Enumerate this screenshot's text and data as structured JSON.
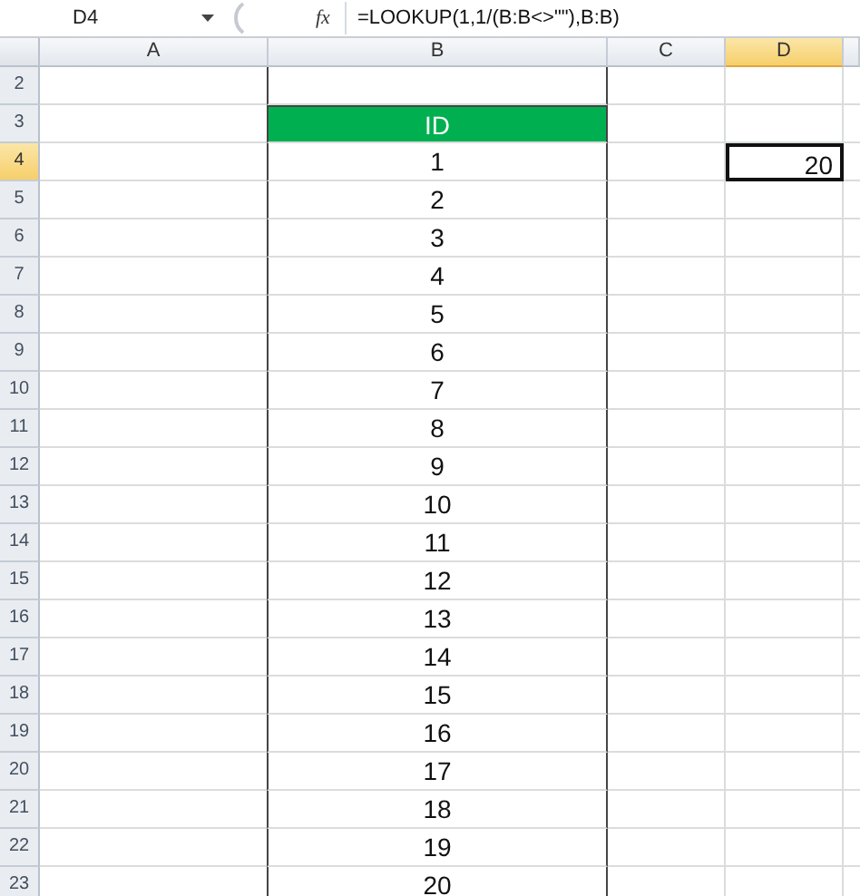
{
  "name_box": "D4",
  "formula_icon": "fx",
  "formula": "=LOOKUP(1,1/(B:B<>\"\"),B:B)",
  "columns": [
    {
      "label": "A",
      "selected": false
    },
    {
      "label": "B",
      "selected": false
    },
    {
      "label": "C",
      "selected": false
    },
    {
      "label": "D",
      "selected": true
    }
  ],
  "rows": [
    {
      "number": "2",
      "selected": false
    },
    {
      "number": "3",
      "selected": false,
      "b": {
        "text": "ID",
        "kind": "header",
        "selected": false
      }
    },
    {
      "number": "4",
      "selected": true,
      "b": {
        "text": "1",
        "kind": "value",
        "selected": false
      },
      "d": {
        "text": "20",
        "kind": "value",
        "selected": true
      }
    },
    {
      "number": "5",
      "selected": false,
      "b": {
        "text": "2",
        "kind": "value",
        "selected": false
      }
    },
    {
      "number": "6",
      "selected": false,
      "b": {
        "text": "3",
        "kind": "value",
        "selected": false
      }
    },
    {
      "number": "7",
      "selected": false,
      "b": {
        "text": "4",
        "kind": "value",
        "selected": false
      }
    },
    {
      "number": "8",
      "selected": false,
      "b": {
        "text": "5",
        "kind": "value",
        "selected": false
      }
    },
    {
      "number": "9",
      "selected": false,
      "b": {
        "text": "6",
        "kind": "value",
        "selected": false
      }
    },
    {
      "number": "10",
      "selected": false,
      "b": {
        "text": "7",
        "kind": "value",
        "selected": false
      }
    },
    {
      "number": "11",
      "selected": false,
      "b": {
        "text": "8",
        "kind": "value",
        "selected": false
      }
    },
    {
      "number": "12",
      "selected": false,
      "b": {
        "text": "9",
        "kind": "value",
        "selected": false
      }
    },
    {
      "number": "13",
      "selected": false,
      "b": {
        "text": "10",
        "kind": "value",
        "selected": false
      }
    },
    {
      "number": "14",
      "selected": false,
      "b": {
        "text": "11",
        "kind": "value",
        "selected": false
      }
    },
    {
      "number": "15",
      "selected": false,
      "b": {
        "text": "12",
        "kind": "value",
        "selected": false
      }
    },
    {
      "number": "16",
      "selected": false,
      "b": {
        "text": "13",
        "kind": "value",
        "selected": false
      }
    },
    {
      "number": "17",
      "selected": false,
      "b": {
        "text": "14",
        "kind": "value",
        "selected": false
      }
    },
    {
      "number": "18",
      "selected": false,
      "b": {
        "text": "15",
        "kind": "value",
        "selected": false
      }
    },
    {
      "number": "19",
      "selected": false,
      "b": {
        "text": "16",
        "kind": "value",
        "selected": false
      }
    },
    {
      "number": "20",
      "selected": false,
      "b": {
        "text": "17",
        "kind": "value",
        "selected": false
      }
    },
    {
      "number": "21",
      "selected": false,
      "b": {
        "text": "18",
        "kind": "value",
        "selected": false
      }
    },
    {
      "number": "22",
      "selected": false,
      "b": {
        "text": "19",
        "kind": "value",
        "selected": false
      }
    },
    {
      "number": "23",
      "selected": false,
      "b": {
        "text": "20",
        "kind": "value",
        "selected": false
      }
    }
  ]
}
